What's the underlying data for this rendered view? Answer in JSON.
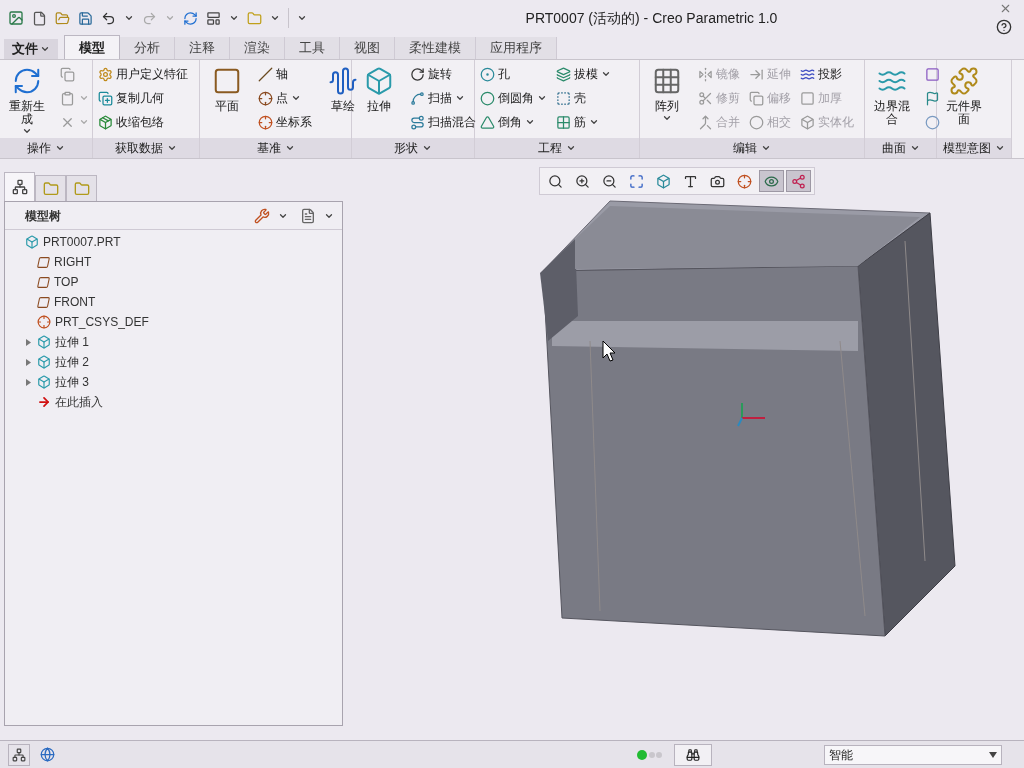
{
  "window": {
    "title": "PRT0007 (活动的) - Creo Parametric 1.0"
  },
  "file_menu": {
    "label": "文件"
  },
  "tabs": [
    {
      "label": "模型",
      "selected": true
    },
    {
      "label": "分析",
      "selected": false
    },
    {
      "label": "注释",
      "selected": false
    },
    {
      "label": "渲染",
      "selected": false
    },
    {
      "label": "工具",
      "selected": false
    },
    {
      "label": "视图",
      "selected": false
    },
    {
      "label": "柔性建模",
      "selected": false
    },
    {
      "label": "应用程序",
      "selected": false
    }
  ],
  "ribbon": {
    "groups": [
      {
        "label": "操作",
        "columns": [
          [
            {
              "kind": "large",
              "label": "重新生成",
              "menu": true,
              "disabled": false
            }
          ],
          [
            {
              "kind": "icon",
              "menu": false,
              "disabled": true
            },
            {
              "kind": "icon",
              "menu": true,
              "disabled": true
            },
            {
              "kind": "icon",
              "menu": true,
              "disabled": true
            }
          ]
        ]
      },
      {
        "label": "获取数据",
        "columns": [
          [
            {
              "kind": "small",
              "label": "用户定义特征",
              "menu": false,
              "disabled": false
            },
            {
              "kind": "small",
              "label": "复制几何",
              "menu": false,
              "disabled": false
            },
            {
              "kind": "small",
              "label": "收缩包络",
              "menu": false,
              "disabled": false
            }
          ]
        ]
      },
      {
        "label": "基准",
        "columns": [
          [
            {
              "kind": "large",
              "label": "平面",
              "menu": false,
              "disabled": false
            }
          ],
          [
            {
              "kind": "small",
              "label": "轴",
              "menu": false,
              "disabled": false
            },
            {
              "kind": "small",
              "label": "点",
              "menu": true,
              "disabled": false
            },
            {
              "kind": "small",
              "label": "坐标系",
              "menu": false,
              "disabled": false
            }
          ],
          [
            {
              "kind": "large",
              "label": "草绘",
              "menu": false,
              "disabled": false
            }
          ]
        ]
      },
      {
        "label": "形状",
        "columns": [
          [
            {
              "kind": "large",
              "label": "拉伸",
              "menu": false,
              "disabled": false
            }
          ],
          [
            {
              "kind": "small",
              "label": "旋转",
              "menu": false,
              "disabled": false
            },
            {
              "kind": "small",
              "label": "扫描",
              "menu": true,
              "disabled": false
            },
            {
              "kind": "small",
              "label": "扫描混合",
              "menu": false,
              "disabled": false
            }
          ]
        ]
      },
      {
        "label": "工程",
        "columns": [
          [
            {
              "kind": "small",
              "label": "孔",
              "menu": false,
              "disabled": false
            },
            {
              "kind": "small",
              "label": "倒圆角",
              "menu": true,
              "disabled": false
            },
            {
              "kind": "small",
              "label": "倒角",
              "menu": true,
              "disabled": false
            }
          ],
          [
            {
              "kind": "small",
              "label": "拔模",
              "menu": true,
              "disabled": false
            },
            {
              "kind": "small",
              "label": "壳",
              "menu": false,
              "disabled": false
            },
            {
              "kind": "small",
              "label": "筋",
              "menu": true,
              "disabled": false
            }
          ]
        ]
      },
      {
        "label": "编辑",
        "columns": [
          [
            {
              "kind": "large",
              "label": "阵列",
              "menu": true,
              "disabled": false
            }
          ],
          [
            {
              "kind": "small",
              "label": "镜像",
              "menu": false,
              "disabled": true
            },
            {
              "kind": "small",
              "label": "修剪",
              "menu": false,
              "disabled": true
            },
            {
              "kind": "small",
              "label": "合并",
              "menu": false,
              "disabled": true
            }
          ],
          [
            {
              "kind": "small",
              "label": "延伸",
              "menu": false,
              "disabled": true
            },
            {
              "kind": "small",
              "label": "偏移",
              "menu": false,
              "disabled": true
            },
            {
              "kind": "small",
              "label": "相交",
              "menu": false,
              "disabled": true
            }
          ],
          [
            {
              "kind": "small",
              "label": "投影",
              "menu": false,
              "disabled": false
            },
            {
              "kind": "small",
              "label": "加厚",
              "menu": false,
              "disabled": true
            },
            {
              "kind": "small",
              "label": "实体化",
              "menu": false,
              "disabled": true
            }
          ]
        ]
      },
      {
        "label": "曲面",
        "columns": [
          [
            {
              "kind": "large",
              "label": "边界混合",
              "menu": false,
              "disabled": false
            }
          ],
          [
            {
              "kind": "icon",
              "menu": false,
              "disabled": false
            },
            {
              "kind": "icon",
              "menu": false,
              "disabled": false
            },
            {
              "kind": "icon",
              "menu": false,
              "disabled": false
            }
          ]
        ]
      },
      {
        "label": "模型意图",
        "columns": [
          [
            {
              "kind": "large",
              "label": "元件界面",
              "menu": false,
              "disabled": false
            }
          ]
        ]
      }
    ]
  },
  "navigator_tabs": [
    {
      "selected": true
    },
    {
      "selected": false
    },
    {
      "selected": false
    }
  ],
  "model_tree": {
    "title": "模型树",
    "root": {
      "label": "PRT0007.PRT",
      "kind": "part",
      "children": [
        {
          "label": "RIGHT",
          "kind": "plane"
        },
        {
          "label": "TOP",
          "kind": "plane"
        },
        {
          "label": "FRONT",
          "kind": "plane"
        },
        {
          "label": "PRT_CSYS_DEF",
          "kind": "csys"
        },
        {
          "label": "拉伸 1",
          "kind": "feature",
          "expanded": false
        },
        {
          "label": "拉伸 2",
          "kind": "feature",
          "expanded": false
        },
        {
          "label": "拉伸 3",
          "kind": "feature",
          "expanded": false
        },
        {
          "label": "在此插入",
          "kind": "insert"
        }
      ]
    }
  },
  "view_toolbar": [
    {
      "on": false
    },
    {
      "on": false
    },
    {
      "on": false
    },
    {
      "on": false
    },
    {
      "on": false
    },
    {
      "on": false
    },
    {
      "on": false
    },
    {
      "on": false
    },
    {
      "on": true
    },
    {
      "on": true
    }
  ],
  "status_bar": {
    "filter": "智能"
  }
}
